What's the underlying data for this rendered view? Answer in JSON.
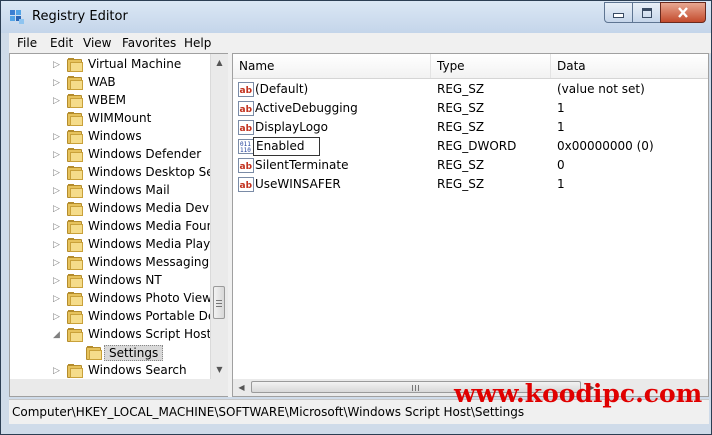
{
  "window": {
    "title": "Registry Editor"
  },
  "menu": [
    "File",
    "Edit",
    "View",
    "Favorites",
    "Help"
  ],
  "tree": [
    {
      "label": "Virtual Machine",
      "expandable": true
    },
    {
      "label": "WAB",
      "expandable": true
    },
    {
      "label": "WBEM",
      "expandable": true
    },
    {
      "label": "WIMMount",
      "expandable": false
    },
    {
      "label": "Windows",
      "expandable": true
    },
    {
      "label": "Windows Defender",
      "expandable": true
    },
    {
      "label": "Windows Desktop Sear",
      "expandable": true
    },
    {
      "label": "Windows Mail",
      "expandable": true
    },
    {
      "label": "Windows Media Device",
      "expandable": true
    },
    {
      "label": "Windows Media Found",
      "expandable": true
    },
    {
      "label": "Windows Media Player",
      "expandable": true
    },
    {
      "label": "Windows Messaging Su",
      "expandable": true
    },
    {
      "label": "Windows NT",
      "expandable": true
    },
    {
      "label": "Windows Photo Viewer",
      "expandable": true
    },
    {
      "label": "Windows Portable Devi",
      "expandable": true
    },
    {
      "label": "Windows Script Host",
      "expandable": true,
      "expanded": true
    },
    {
      "label": "Settings",
      "child": true,
      "selected": true
    },
    {
      "label": "Windows Search",
      "expandable": true
    }
  ],
  "columns": {
    "name": "Name",
    "type": "Type",
    "data": "Data"
  },
  "values": [
    {
      "name": "(Default)",
      "type": "REG_SZ",
      "data": "(value not set)",
      "icon": "string-value-icon"
    },
    {
      "name": "ActiveDebugging",
      "type": "REG_SZ",
      "data": "1",
      "icon": "string-value-icon"
    },
    {
      "name": "DisplayLogo",
      "type": "REG_SZ",
      "data": "1",
      "icon": "string-value-icon"
    },
    {
      "name": "Enabled",
      "type": "REG_DWORD",
      "data": "0x00000000 (0)",
      "icon": "dword-value-icon",
      "editing": true
    },
    {
      "name": "SilentTerminate",
      "type": "REG_SZ",
      "data": "0",
      "icon": "string-value-icon"
    },
    {
      "name": "UseWINSAFER",
      "type": "REG_SZ",
      "data": "1",
      "icon": "string-value-icon"
    }
  ],
  "status": {
    "path": "Computer\\HKEY_LOCAL_MACHINE\\SOFTWARE\\Microsoft\\Windows Script Host\\Settings"
  },
  "watermark": "www.koodipc.com",
  "colors": {
    "title_bar": "#c9d9ed",
    "close_button": "#c34b2d",
    "watermark": "#e00000",
    "folder": "#e6c25c"
  }
}
